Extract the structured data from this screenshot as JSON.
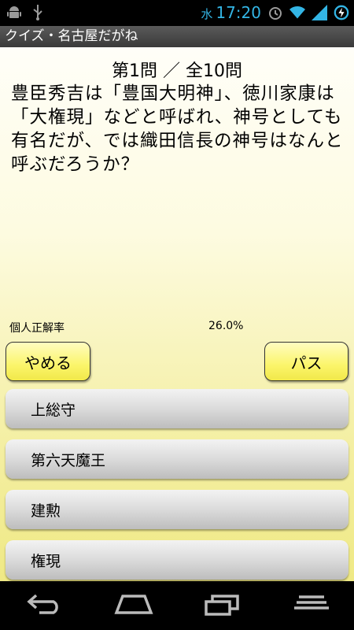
{
  "status_bar": {
    "day_of_week": "水",
    "time": "17:20",
    "icons": [
      "android-debug-icon",
      "usb-icon",
      "alarm-icon",
      "wifi-icon",
      "signal-icon",
      "battery-charging-icon"
    ]
  },
  "app": {
    "title": "クイズ・名古屋だがね"
  },
  "quiz": {
    "question_number": "第1問 ／ 全10問",
    "question_text": "豊臣秀吉は「豊国大明神」、徳川家康は「大権現」などと呼ばれ、神号としても有名だが、では織田信長の神号はなんと呼ぶだろうか？",
    "rate_label": "個人正解率",
    "rate_value": "26.0%",
    "quit_label": "やめる",
    "pass_label": "パス",
    "answers": [
      "上総守",
      "第六天魔王",
      "建勲",
      "権現"
    ]
  },
  "nav_bar": {
    "icons": [
      "back-icon",
      "home-icon",
      "recent-apps-icon",
      "menu-icon"
    ]
  },
  "colors": {
    "clock": "#33b5e5",
    "button_yellow": "#fbf56a",
    "answer_gray": "#d8d8d8",
    "background_yellow": "#f5f0a8"
  }
}
